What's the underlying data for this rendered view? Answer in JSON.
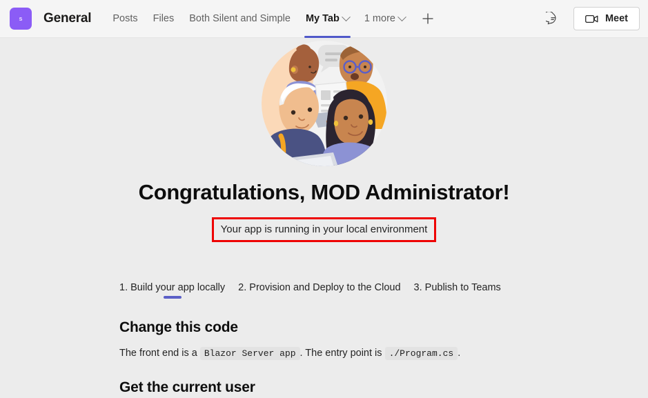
{
  "header": {
    "avatar": {
      "initial": "s",
      "name": "team-avatar",
      "color": "#8b5cf6"
    },
    "channel_title": "General",
    "tabs": [
      {
        "label": "Posts",
        "active": false,
        "has_chevron": false
      },
      {
        "label": "Files",
        "active": false,
        "has_chevron": false
      },
      {
        "label": "Both Silent and Simple",
        "active": false,
        "has_chevron": false
      },
      {
        "label": "My Tab",
        "active": true,
        "has_chevron": true
      },
      {
        "label": "1 more",
        "active": false,
        "has_chevron": true
      }
    ],
    "add_tab_label": "+",
    "chat_icon": "chat-bubble-icon",
    "meet_button": {
      "label": "Meet",
      "icon": "video-camera-icon"
    }
  },
  "main": {
    "illustration": "people-collaboration-illustration",
    "congratulations": "Congratulations, MOD Administrator!",
    "status_message": "Your app is running in your local environment",
    "status_border_color": "#ee0000",
    "steps": [
      {
        "label": "1. Build your app locally",
        "active": true
      },
      {
        "label": "2. Provision and Deploy to the Cloud",
        "active": false
      },
      {
        "label": "3. Publish to Teams",
        "active": false
      }
    ],
    "change_code": {
      "heading": "Change this code",
      "text_before": "The front end is a",
      "code_1": "Blazor Server app",
      "text_middle": ". The entry point is",
      "code_2": "./Program.cs",
      "text_after": "."
    },
    "current_user": {
      "heading": "Get the current user"
    }
  },
  "colors": {
    "accent_purple": "#5059c9",
    "step_indicator": "#5b5fc7",
    "header_bg": "#f5f5f5",
    "content_bg": "#ececec"
  }
}
